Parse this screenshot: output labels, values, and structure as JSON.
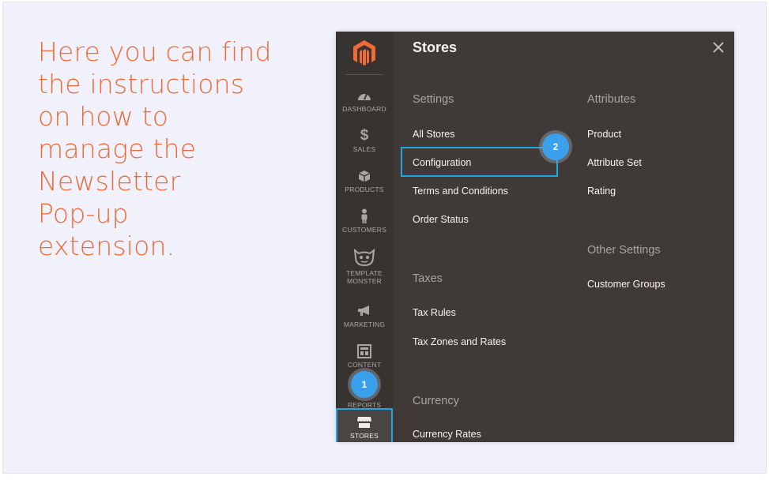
{
  "intro": {
    "lines": [
      "Here you can find",
      "the instructions",
      "on how to",
      "manage the",
      "Newsletter",
      "Pop-up",
      "extension."
    ]
  },
  "colors": {
    "accent_text": "#ef6a37",
    "highlight": "#1fa5e0",
    "badge": "#3aa0ee",
    "menu_bg": "#3f3a37",
    "rail_bg": "#373330"
  },
  "sidebar": {
    "logo_icon": "magento-logo-icon",
    "items": [
      {
        "label": "DASHBOARD",
        "icon": "gauge-icon"
      },
      {
        "label": "SALES",
        "icon": "dollar-icon"
      },
      {
        "label": "PRODUCTS",
        "icon": "box-icon"
      },
      {
        "label": "CUSTOMERS",
        "icon": "person-icon"
      },
      {
        "label": "TEMPLATE MONSTER",
        "icon": "monster-icon"
      },
      {
        "label": "MARKETING",
        "icon": "megaphone-icon"
      },
      {
        "label": "CONTENT",
        "icon": "layout-icon"
      },
      {
        "label": "REPORTS",
        "icon": "chart-icon"
      },
      {
        "label": "STORES",
        "icon": "store-icon",
        "active": true
      }
    ]
  },
  "panel": {
    "title": "Stores",
    "close_icon": "close-icon",
    "settings": {
      "heading": "Settings",
      "links": [
        "All Stores",
        "Configuration",
        "Terms and Conditions",
        "Order Status"
      ]
    },
    "taxes": {
      "heading": "Taxes",
      "links": [
        "Tax Rules",
        "Tax Zones and Rates"
      ]
    },
    "currency": {
      "heading": "Currency",
      "links": [
        "Currency Rates"
      ]
    },
    "attributes": {
      "heading": "Attributes",
      "links": [
        "Product",
        "Attribute Set",
        "Rating"
      ]
    },
    "other": {
      "heading": "Other Settings",
      "links": [
        "Customer Groups"
      ]
    }
  },
  "steps": [
    {
      "number": "1"
    },
    {
      "number": "2"
    }
  ]
}
